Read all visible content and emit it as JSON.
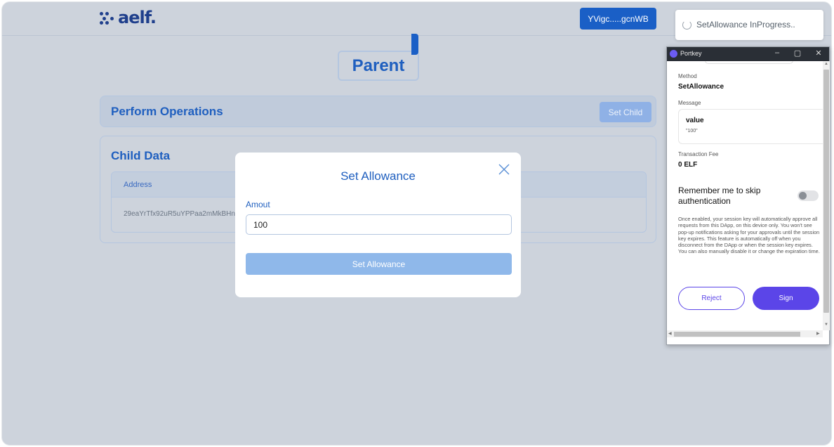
{
  "header": {
    "logo_text": "aelf.",
    "wallet_address": "YVigc.....gcnWB"
  },
  "page": {
    "title": "Parent"
  },
  "operations": {
    "title": "Perform Operations",
    "set_child_label": "Set Child"
  },
  "child_data": {
    "title": "Child Data",
    "columns": [
      "Address"
    ],
    "rows": [
      {
        "address": "29eaYrTfx92uR5uYPPaa2mMkBHnS"
      }
    ]
  },
  "modal": {
    "title": "Set Allowance",
    "amount_label": "Amout",
    "amount_value": "100",
    "submit_label": "Set Allowance",
    "close_icon": "close-icon"
  },
  "toast": {
    "text": "SetAllowance InProgress.."
  },
  "portkey": {
    "window_title": "Portkey",
    "controls": [
      "–",
      "▢",
      "✕"
    ],
    "method_label": "Method",
    "method_value": "SetAllowance",
    "message_label": "Message",
    "message_key": "value",
    "message_value": "\"100\"",
    "fee_label": "Transaction Fee",
    "fee_value": "0 ELF",
    "remember_label": "Remember me to skip authentication",
    "remember_enabled": false,
    "description": "Once enabled, your session key will automatically approve all requests from this DApp, on this device only. You won't see pop-up notifications asking for your approvals until the session key expires. This feature is automatically off when you disconnect from the DApp or when the session key expires. You can also manually disable it or change the expiration time.",
    "reject_label": "Reject",
    "sign_label": "Sign"
  },
  "colors": {
    "brand": "#1a5fc6",
    "portkey_accent": "#5b45e8",
    "overlay": "#cdd3dc"
  }
}
